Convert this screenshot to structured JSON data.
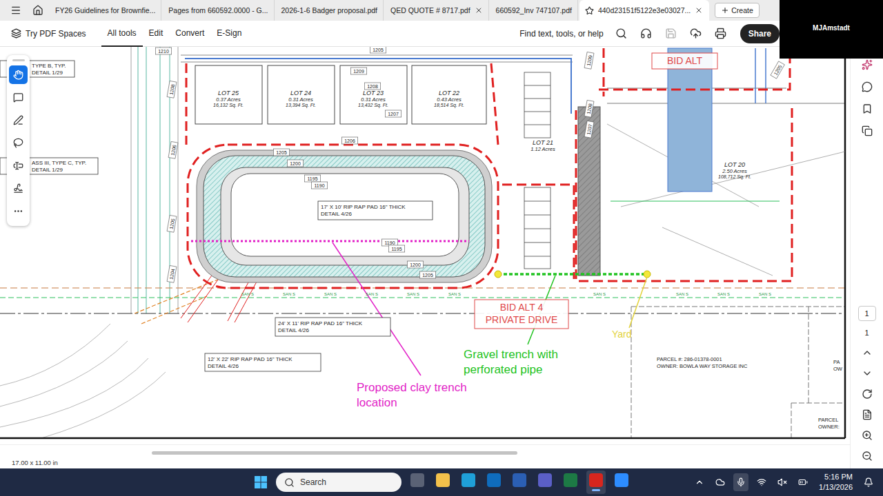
{
  "tabs": [
    {
      "label": "FY26 Guidelines for Brownfie...",
      "selected": false,
      "starred": false,
      "closable": false
    },
    {
      "label": "Pages from 660592.0000 - G...",
      "selected": false,
      "starred": false,
      "closable": false
    },
    {
      "label": "2026-1-6 Badger proposal.pdf",
      "selected": false,
      "starred": false,
      "closable": false
    },
    {
      "label": "QED QUOTE # 8717.pdf",
      "selected": false,
      "starred": false,
      "closable": true
    },
    {
      "label": "660592_Inv 747107.pdf",
      "selected": false,
      "starred": false,
      "closable": false
    },
    {
      "label": "440d23151f5122e3e03027...",
      "selected": true,
      "starred": true,
      "closable": true
    }
  ],
  "create": "Create",
  "toolbar": {
    "spaces": "Try PDF Spaces",
    "menu": [
      {
        "label": "All tools",
        "selected": true
      },
      {
        "label": "Edit",
        "selected": false
      },
      {
        "label": "Convert",
        "selected": false
      },
      {
        "label": "E-Sign",
        "selected": false
      }
    ],
    "find": "Find text, tools, or help",
    "save_disabled": true,
    "share": "Share"
  },
  "video": {
    "name": "MJAmstadt"
  },
  "tools": [
    {
      "selected": true
    },
    {
      "selected": false
    },
    {
      "selected": false
    },
    {
      "selected": false
    },
    {
      "selected": false
    },
    {
      "selected": false
    },
    {
      "selected": false
    }
  ],
  "drawing": {
    "details": [
      {
        "lines": [
          "TYPE B, TYP.",
          "DETAIL 1/29"
        ]
      },
      {
        "lines": [
          "ASS III, TYPE C, TYP.",
          "DETAIL 1/29"
        ]
      }
    ],
    "lots": [
      {
        "name": "LOT 25",
        "acres": "0.37 Acres",
        "area": "16,132 Sq. Ft."
      },
      {
        "name": "LOT 24",
        "acres": "0.31 Acres",
        "area": "13,394 Sq. Ft."
      },
      {
        "name": "LOT 23",
        "acres": "0.31 Acres",
        "area": "13,432 Sq. Ft."
      },
      {
        "name": "LOT 22",
        "acres": "0.43 Acres",
        "area": "18,514 Sq. Ft."
      },
      {
        "name": "LOT 21",
        "acres": "1.12 Acres"
      },
      {
        "name": "LOT 20",
        "acres": "2.50 Acres",
        "area": "108,712 Sq. Ft."
      }
    ],
    "contours": [
      "1210",
      "1205",
      "1209",
      "1208",
      "1207",
      "1206",
      "1205",
      "1200",
      "1195",
      "1190",
      "1190",
      "1195",
      "1200",
      "1205",
      "1204",
      "1205",
      "1206",
      "1208",
      "1209",
      "1208",
      "1207",
      "1205"
    ],
    "callouts": [
      {
        "lines": [
          "17' X 10' RIP RAP PAD 16\" THICK",
          "DETAIL 4/26"
        ]
      },
      {
        "lines": [
          "24' X 11' RIP RAP PAD 16\" THICK",
          "DETAIL 4/26"
        ]
      },
      {
        "lines": [
          "12' X 22' RIP RAP PAD 16\" THICK",
          "DETAIL 4/26"
        ]
      }
    ],
    "bid_alts": [
      {
        "lines": [
          "BID ALT"
        ]
      },
      {
        "lines": [
          "BID ALT 4",
          "PRIVATE DRIVE"
        ]
      }
    ],
    "annotations": [
      {
        "lines": [
          "Proposed clay trench",
          "location"
        ],
        "color": "#e21fc7"
      },
      {
        "lines": [
          "Gravel trench with",
          "perforated pipe"
        ],
        "color": "#22c322"
      },
      {
        "lines": [
          "Yard"
        ],
        "color": "#e2d23a"
      }
    ],
    "parcels": [
      {
        "lines": [
          "PARCEL #: 286-01378-0001",
          "OWNER: BOWLA WAY STORAGE INC"
        ]
      },
      {
        "lines": [
          "PARCEL",
          "OWNER:"
        ]
      },
      {
        "lines": [
          "PA",
          "OW"
        ]
      }
    ],
    "sewer_label": "SAN S"
  },
  "page": {
    "current": "1",
    "total": "1",
    "size": "17.00 x 11.00 in"
  },
  "taskbar": {
    "search": "Search",
    "apps": [
      {
        "active": false,
        "color": "#5a6275"
      },
      {
        "active": false,
        "color": "#f3c14b"
      },
      {
        "active": false,
        "color": "#1fa0d8"
      },
      {
        "active": false,
        "color": "#0f6cbd"
      },
      {
        "active": false,
        "color": "#2b5fb4"
      },
      {
        "active": false,
        "color": "#5b5fc7"
      },
      {
        "active": false,
        "color": "#1d7a45"
      },
      {
        "active": true,
        "color": "#d7261e"
      },
      {
        "active": false,
        "color": "#2d8cff"
      }
    ],
    "mic_active": true,
    "time": "5:16 PM",
    "date": "1/13/2026"
  }
}
